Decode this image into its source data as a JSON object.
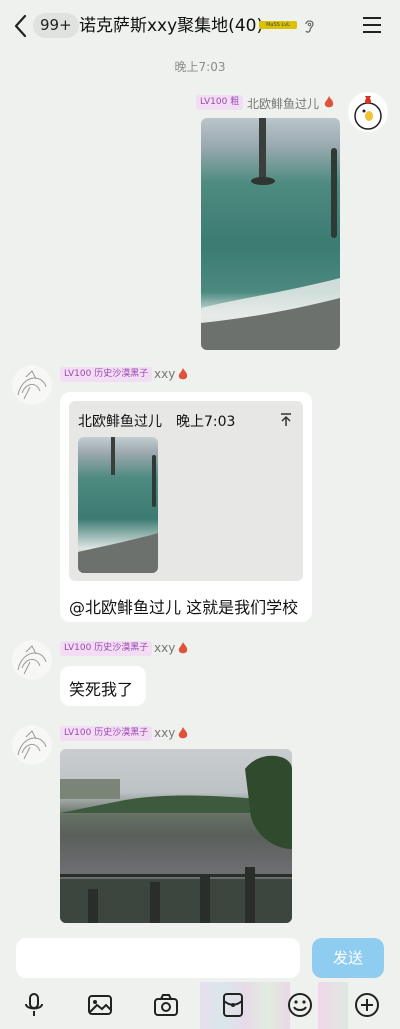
{
  "header": {
    "unread_count": "99+",
    "title": "诺克萨斯xxy聚集地(40)",
    "tag_text": "MaSS LvL"
  },
  "timestamp": "晚上7:03",
  "messages": [
    {
      "sender": "北欧鲱鱼过儿",
      "level": "LV100 粗",
      "side": "right",
      "type": "image"
    },
    {
      "sender": "xxy",
      "level": "LV100 历史沙漠黑子",
      "side": "left",
      "type": "quote",
      "quote": {
        "author": "北欧鲱鱼过儿",
        "time": "晚上7:03"
      },
      "text": "@北欧鲱鱼过儿 这就是我们学校"
    },
    {
      "sender": "xxy",
      "level": "LV100 历史沙漠黑子",
      "side": "left",
      "type": "text",
      "text": "笑死我了"
    },
    {
      "sender": "xxy",
      "level": "LV100 历史沙漠黑子",
      "side": "left",
      "type": "image"
    }
  ],
  "input": {
    "placeholder": "",
    "send_label": "发送"
  },
  "toolbar": [
    "mic-icon",
    "image-icon",
    "camera-icon",
    "red-packet-icon",
    "emoji-icon",
    "plus-icon"
  ],
  "colors": {
    "send_button": "#8ecdf0",
    "level_badge_bg": "#f3ddf5",
    "level_badge_text": "#9a4bb0",
    "background": "#eef1ed"
  }
}
